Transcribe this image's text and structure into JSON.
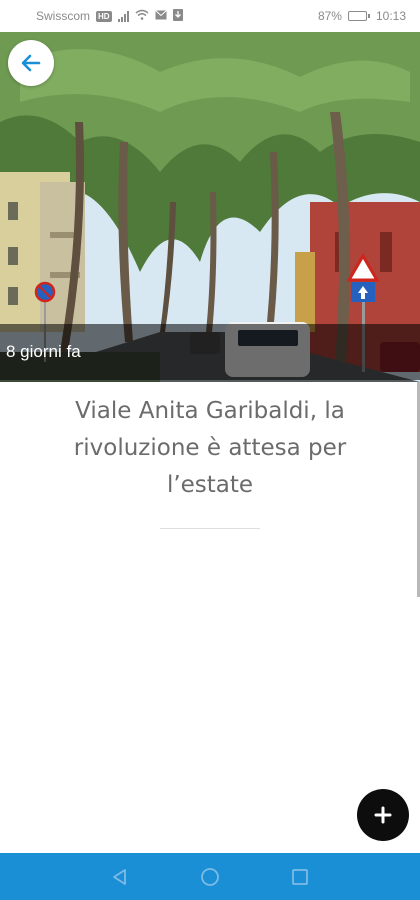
{
  "status_bar": {
    "carrier": "Swisscom",
    "network_badge": "HD",
    "battery_percent": "87%",
    "battery_level": 0.87,
    "time": "10:13",
    "icons": [
      "signal-icon",
      "wifi-icon",
      "mail-icon",
      "download-icon",
      "battery-icon"
    ]
  },
  "header": {
    "back_icon": "arrow-left-icon",
    "hero_image": "tree-lined-street-photo"
  },
  "article": {
    "age": "8 giorni fa",
    "title": "Viale Anita Garibaldi, la rivoluzione è attesa per l’estate"
  },
  "fab": {
    "icon": "plus-icon"
  },
  "nav_bar": {
    "color": "#1a8fd6",
    "buttons": [
      "back-triangle-icon",
      "home-circle-icon",
      "recents-square-icon"
    ]
  },
  "colors": {
    "title_text": "#6b6b6b",
    "fab": "#0d0d0d",
    "accent": "#1a8fd6"
  }
}
